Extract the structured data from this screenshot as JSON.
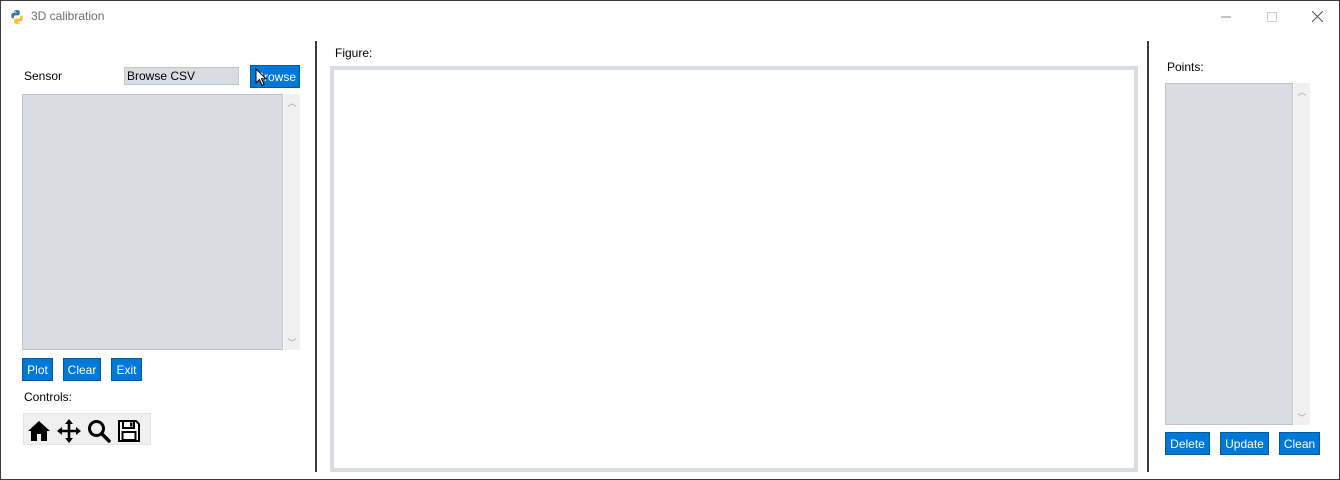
{
  "window": {
    "title": "3D calibration",
    "minimize_glyph": "─",
    "maximize_glyph": "☐",
    "close_glyph": "✕"
  },
  "sensor": {
    "label": "Sensor",
    "entry_value": "Browse CSV",
    "browse_button": "Browse"
  },
  "left_buttons": {
    "plot": "Plot",
    "clear": "Clear",
    "exit": "Exit"
  },
  "controls": {
    "label": "Controls:",
    "tools": [
      "home-icon",
      "move-icon",
      "zoom-icon",
      "save-icon"
    ]
  },
  "figure": {
    "label": "Figure:"
  },
  "points": {
    "label": "Points:",
    "delete_button": "Delete",
    "update_button": "Update",
    "clean_button": "Clean"
  },
  "colors": {
    "button_bg": "#0078d7",
    "listbox_bg": "#d9dde3"
  }
}
